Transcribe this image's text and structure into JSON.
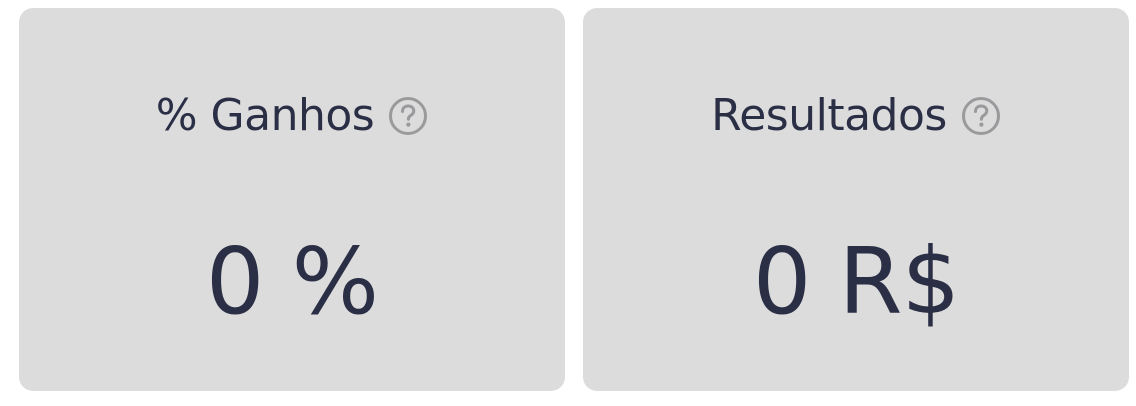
{
  "cards": [
    {
      "title": "% Ganhos",
      "value": "0 %",
      "help_icon": "question-circle-icon"
    },
    {
      "title": "Resultados",
      "value": "0 R$",
      "help_icon": "question-circle-icon"
    }
  ],
  "colors": {
    "card_background": "#dcdcdd",
    "text": "#2b2f45",
    "icon": "#9a9a9c"
  }
}
